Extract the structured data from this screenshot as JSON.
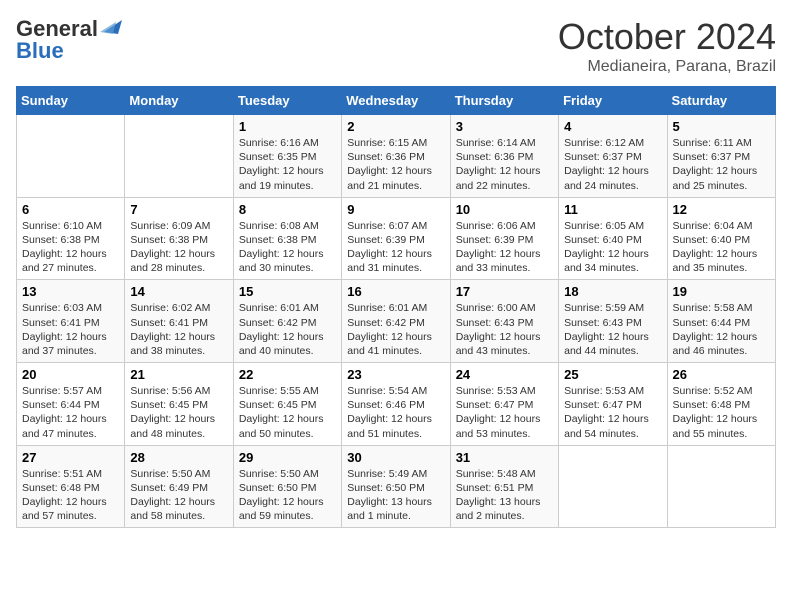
{
  "header": {
    "logo_general": "General",
    "logo_blue": "Blue",
    "title": "October 2024",
    "subtitle": "Medianeira, Parana, Brazil"
  },
  "days_of_week": [
    "Sunday",
    "Monday",
    "Tuesday",
    "Wednesday",
    "Thursday",
    "Friday",
    "Saturday"
  ],
  "weeks": [
    [
      {
        "day": "",
        "info": ""
      },
      {
        "day": "",
        "info": ""
      },
      {
        "day": "1",
        "info": "Sunrise: 6:16 AM\nSunset: 6:35 PM\nDaylight: 12 hours and 19 minutes."
      },
      {
        "day": "2",
        "info": "Sunrise: 6:15 AM\nSunset: 6:36 PM\nDaylight: 12 hours and 21 minutes."
      },
      {
        "day": "3",
        "info": "Sunrise: 6:14 AM\nSunset: 6:36 PM\nDaylight: 12 hours and 22 minutes."
      },
      {
        "day": "4",
        "info": "Sunrise: 6:12 AM\nSunset: 6:37 PM\nDaylight: 12 hours and 24 minutes."
      },
      {
        "day": "5",
        "info": "Sunrise: 6:11 AM\nSunset: 6:37 PM\nDaylight: 12 hours and 25 minutes."
      }
    ],
    [
      {
        "day": "6",
        "info": "Sunrise: 6:10 AM\nSunset: 6:38 PM\nDaylight: 12 hours and 27 minutes."
      },
      {
        "day": "7",
        "info": "Sunrise: 6:09 AM\nSunset: 6:38 PM\nDaylight: 12 hours and 28 minutes."
      },
      {
        "day": "8",
        "info": "Sunrise: 6:08 AM\nSunset: 6:38 PM\nDaylight: 12 hours and 30 minutes."
      },
      {
        "day": "9",
        "info": "Sunrise: 6:07 AM\nSunset: 6:39 PM\nDaylight: 12 hours and 31 minutes."
      },
      {
        "day": "10",
        "info": "Sunrise: 6:06 AM\nSunset: 6:39 PM\nDaylight: 12 hours and 33 minutes."
      },
      {
        "day": "11",
        "info": "Sunrise: 6:05 AM\nSunset: 6:40 PM\nDaylight: 12 hours and 34 minutes."
      },
      {
        "day": "12",
        "info": "Sunrise: 6:04 AM\nSunset: 6:40 PM\nDaylight: 12 hours and 35 minutes."
      }
    ],
    [
      {
        "day": "13",
        "info": "Sunrise: 6:03 AM\nSunset: 6:41 PM\nDaylight: 12 hours and 37 minutes."
      },
      {
        "day": "14",
        "info": "Sunrise: 6:02 AM\nSunset: 6:41 PM\nDaylight: 12 hours and 38 minutes."
      },
      {
        "day": "15",
        "info": "Sunrise: 6:01 AM\nSunset: 6:42 PM\nDaylight: 12 hours and 40 minutes."
      },
      {
        "day": "16",
        "info": "Sunrise: 6:01 AM\nSunset: 6:42 PM\nDaylight: 12 hours and 41 minutes."
      },
      {
        "day": "17",
        "info": "Sunrise: 6:00 AM\nSunset: 6:43 PM\nDaylight: 12 hours and 43 minutes."
      },
      {
        "day": "18",
        "info": "Sunrise: 5:59 AM\nSunset: 6:43 PM\nDaylight: 12 hours and 44 minutes."
      },
      {
        "day": "19",
        "info": "Sunrise: 5:58 AM\nSunset: 6:44 PM\nDaylight: 12 hours and 46 minutes."
      }
    ],
    [
      {
        "day": "20",
        "info": "Sunrise: 5:57 AM\nSunset: 6:44 PM\nDaylight: 12 hours and 47 minutes."
      },
      {
        "day": "21",
        "info": "Sunrise: 5:56 AM\nSunset: 6:45 PM\nDaylight: 12 hours and 48 minutes."
      },
      {
        "day": "22",
        "info": "Sunrise: 5:55 AM\nSunset: 6:45 PM\nDaylight: 12 hours and 50 minutes."
      },
      {
        "day": "23",
        "info": "Sunrise: 5:54 AM\nSunset: 6:46 PM\nDaylight: 12 hours and 51 minutes."
      },
      {
        "day": "24",
        "info": "Sunrise: 5:53 AM\nSunset: 6:47 PM\nDaylight: 12 hours and 53 minutes."
      },
      {
        "day": "25",
        "info": "Sunrise: 5:53 AM\nSunset: 6:47 PM\nDaylight: 12 hours and 54 minutes."
      },
      {
        "day": "26",
        "info": "Sunrise: 5:52 AM\nSunset: 6:48 PM\nDaylight: 12 hours and 55 minutes."
      }
    ],
    [
      {
        "day": "27",
        "info": "Sunrise: 5:51 AM\nSunset: 6:48 PM\nDaylight: 12 hours and 57 minutes."
      },
      {
        "day": "28",
        "info": "Sunrise: 5:50 AM\nSunset: 6:49 PM\nDaylight: 12 hours and 58 minutes."
      },
      {
        "day": "29",
        "info": "Sunrise: 5:50 AM\nSunset: 6:50 PM\nDaylight: 12 hours and 59 minutes."
      },
      {
        "day": "30",
        "info": "Sunrise: 5:49 AM\nSunset: 6:50 PM\nDaylight: 13 hours and 1 minute."
      },
      {
        "day": "31",
        "info": "Sunrise: 5:48 AM\nSunset: 6:51 PM\nDaylight: 13 hours and 2 minutes."
      },
      {
        "day": "",
        "info": ""
      },
      {
        "day": "",
        "info": ""
      }
    ]
  ]
}
